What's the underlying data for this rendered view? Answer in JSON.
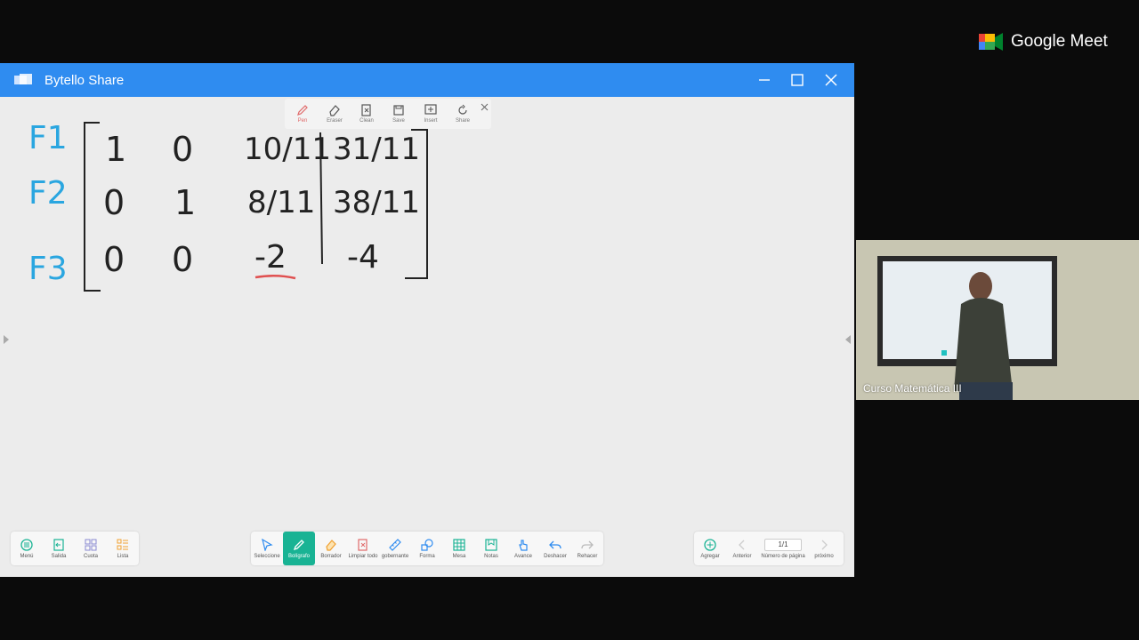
{
  "meet": {
    "brand": "Google Meet"
  },
  "window": {
    "title": "Bytello Share",
    "controls": [
      "minimize",
      "maximize",
      "close"
    ]
  },
  "mini_toolbar": {
    "items": [
      {
        "label": "Pen",
        "icon": "pen-icon",
        "active": true
      },
      {
        "label": "Eraser",
        "icon": "eraser-icon"
      },
      {
        "label": "Clean",
        "icon": "clean-icon"
      },
      {
        "label": "Save",
        "icon": "save-icon"
      },
      {
        "label": "Insert",
        "icon": "insert-icon"
      },
      {
        "label": "Share",
        "icon": "share-icon"
      }
    ]
  },
  "whiteboard": {
    "row_labels": [
      "F1",
      "F2",
      "F3"
    ],
    "matrix": [
      [
        "1",
        "0",
        "10/11",
        "31/11"
      ],
      [
        "0",
        "1",
        "8/11",
        "38/11"
      ],
      [
        "0",
        "0",
        "-2",
        "-4"
      ]
    ],
    "highlight_color": "#e05050",
    "label_color": "#2aa6e0"
  },
  "left_toolbar": {
    "items": [
      {
        "label": "Menú",
        "icon": "menu-icon"
      },
      {
        "label": "Salida",
        "icon": "exit-icon"
      },
      {
        "label": "Cuota",
        "icon": "apps-icon"
      },
      {
        "label": "Lista",
        "icon": "list-icon"
      }
    ]
  },
  "center_toolbar": {
    "items": [
      {
        "label": "Seleccione",
        "icon": "select-icon"
      },
      {
        "label": "Bolígrafo",
        "icon": "pen-icon",
        "active": true
      },
      {
        "label": "Borrador",
        "icon": "eraser-icon"
      },
      {
        "label": "Limpiar todo",
        "icon": "clear-all-icon"
      },
      {
        "label": "gobernante",
        "icon": "ruler-icon"
      },
      {
        "label": "Forma",
        "icon": "shape-icon"
      },
      {
        "label": "Mesa",
        "icon": "table-icon"
      },
      {
        "label": "Notas",
        "icon": "notes-icon"
      },
      {
        "label": "Avance",
        "icon": "pointer-icon"
      },
      {
        "label": "Deshacer",
        "icon": "undo-icon"
      },
      {
        "label": "Rehacer",
        "icon": "redo-icon"
      }
    ],
    "accent": "#19b394"
  },
  "right_toolbar": {
    "add_label": "Agregar",
    "prev_label": "Anterior",
    "page_value": "1/1",
    "page_label": "Número de página",
    "next_label": "próximo"
  },
  "camera": {
    "label": "Curso Matemática III"
  }
}
